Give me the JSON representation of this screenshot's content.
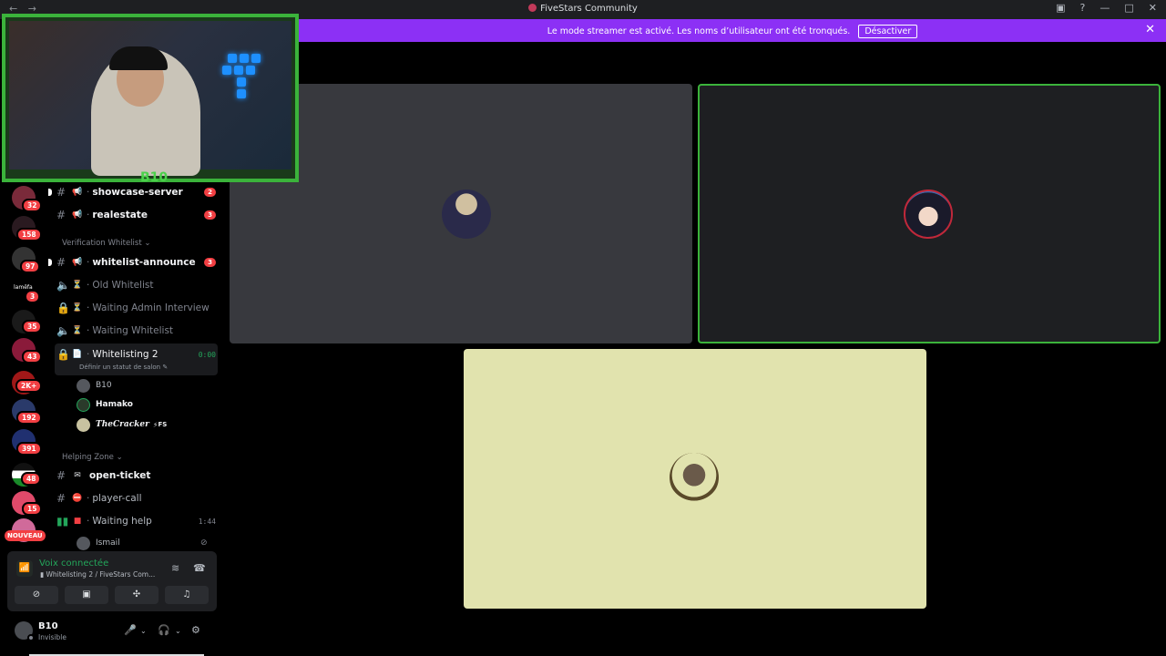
{
  "titlebar": {
    "title": "FiveStars Community",
    "back": "←",
    "forward": "→"
  },
  "streamer": {
    "message": "Le mode streamer est activé. Les noms d’utilisateur ont été tronqués.",
    "button": "Désactiver"
  },
  "guild_badges": [
    "32",
    "158",
    "97",
    "3",
    "35",
    "43",
    "2K+",
    "192",
    "391",
    "48",
    "15"
  ],
  "guild_text_icon": "lamēfa",
  "nouveau": "NOUVEAU",
  "channels": {
    "showcase": {
      "name": "showcase-server",
      "count": "2"
    },
    "realestate": {
      "name": "realestate",
      "count": "3"
    },
    "cat_verification": "Verification Whitelist",
    "whitelist_announce": {
      "name": "whitelist-announce",
      "count": "3"
    },
    "old_whitelist": "Old Whitelist",
    "waiting_admin": "Waiting Admin Interview",
    "waiting_whitelist": "Waiting Whitelist",
    "whitelisting2": {
      "name": "Whitelisting 2",
      "time": "0:00",
      "status": "Définir un statut de salon"
    },
    "voice_users": [
      "B10",
      "Hamako",
      "TheCracker",
      "FS"
    ],
    "cat_helping": "Helping Zone",
    "open_ticket": "open-ticket",
    "player_call": "player-call",
    "waiting_help": {
      "name": "Waiting help",
      "time": "1:44"
    },
    "ismail": "Ismail"
  },
  "voice_panel": {
    "title": "Voix connectée",
    "subtitle": "Whitelisting 2 / FiveStars Com..."
  },
  "user": {
    "name": "B10",
    "status": "Invisible"
  },
  "webcam_logo": "B10",
  "colors": {
    "accent_purple": "#8c30f5",
    "speaking_green": "#3bb33b",
    "badge_red": "#f23f43",
    "tile_yellow": "#e1e3ae"
  }
}
